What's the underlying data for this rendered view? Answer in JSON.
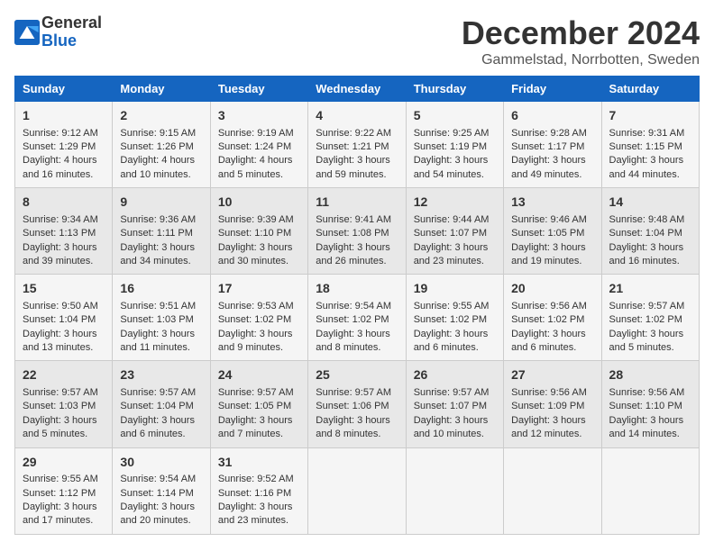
{
  "header": {
    "logo_general": "General",
    "logo_blue": "Blue",
    "month_title": "December 2024",
    "location": "Gammelstad, Norrbotten, Sweden"
  },
  "days_of_week": [
    "Sunday",
    "Monday",
    "Tuesday",
    "Wednesday",
    "Thursday",
    "Friday",
    "Saturday"
  ],
  "weeks": [
    [
      {
        "day": 1,
        "sunrise": "Sunrise: 9:12 AM",
        "sunset": "Sunset: 1:29 PM",
        "daylight": "Daylight: 4 hours and 16 minutes."
      },
      {
        "day": 2,
        "sunrise": "Sunrise: 9:15 AM",
        "sunset": "Sunset: 1:26 PM",
        "daylight": "Daylight: 4 hours and 10 minutes."
      },
      {
        "day": 3,
        "sunrise": "Sunrise: 9:19 AM",
        "sunset": "Sunset: 1:24 PM",
        "daylight": "Daylight: 4 hours and 5 minutes."
      },
      {
        "day": 4,
        "sunrise": "Sunrise: 9:22 AM",
        "sunset": "Sunset: 1:21 PM",
        "daylight": "Daylight: 3 hours and 59 minutes."
      },
      {
        "day": 5,
        "sunrise": "Sunrise: 9:25 AM",
        "sunset": "Sunset: 1:19 PM",
        "daylight": "Daylight: 3 hours and 54 minutes."
      },
      {
        "day": 6,
        "sunrise": "Sunrise: 9:28 AM",
        "sunset": "Sunset: 1:17 PM",
        "daylight": "Daylight: 3 hours and 49 minutes."
      },
      {
        "day": 7,
        "sunrise": "Sunrise: 9:31 AM",
        "sunset": "Sunset: 1:15 PM",
        "daylight": "Daylight: 3 hours and 44 minutes."
      }
    ],
    [
      {
        "day": 8,
        "sunrise": "Sunrise: 9:34 AM",
        "sunset": "Sunset: 1:13 PM",
        "daylight": "Daylight: 3 hours and 39 minutes."
      },
      {
        "day": 9,
        "sunrise": "Sunrise: 9:36 AM",
        "sunset": "Sunset: 1:11 PM",
        "daylight": "Daylight: 3 hours and 34 minutes."
      },
      {
        "day": 10,
        "sunrise": "Sunrise: 9:39 AM",
        "sunset": "Sunset: 1:10 PM",
        "daylight": "Daylight: 3 hours and 30 minutes."
      },
      {
        "day": 11,
        "sunrise": "Sunrise: 9:41 AM",
        "sunset": "Sunset: 1:08 PM",
        "daylight": "Daylight: 3 hours and 26 minutes."
      },
      {
        "day": 12,
        "sunrise": "Sunrise: 9:44 AM",
        "sunset": "Sunset: 1:07 PM",
        "daylight": "Daylight: 3 hours and 23 minutes."
      },
      {
        "day": 13,
        "sunrise": "Sunrise: 9:46 AM",
        "sunset": "Sunset: 1:05 PM",
        "daylight": "Daylight: 3 hours and 19 minutes."
      },
      {
        "day": 14,
        "sunrise": "Sunrise: 9:48 AM",
        "sunset": "Sunset: 1:04 PM",
        "daylight": "Daylight: 3 hours and 16 minutes."
      }
    ],
    [
      {
        "day": 15,
        "sunrise": "Sunrise: 9:50 AM",
        "sunset": "Sunset: 1:04 PM",
        "daylight": "Daylight: 3 hours and 13 minutes."
      },
      {
        "day": 16,
        "sunrise": "Sunrise: 9:51 AM",
        "sunset": "Sunset: 1:03 PM",
        "daylight": "Daylight: 3 hours and 11 minutes."
      },
      {
        "day": 17,
        "sunrise": "Sunrise: 9:53 AM",
        "sunset": "Sunset: 1:02 PM",
        "daylight": "Daylight: 3 hours and 9 minutes."
      },
      {
        "day": 18,
        "sunrise": "Sunrise: 9:54 AM",
        "sunset": "Sunset: 1:02 PM",
        "daylight": "Daylight: 3 hours and 8 minutes."
      },
      {
        "day": 19,
        "sunrise": "Sunrise: 9:55 AM",
        "sunset": "Sunset: 1:02 PM",
        "daylight": "Daylight: 3 hours and 6 minutes."
      },
      {
        "day": 20,
        "sunrise": "Sunrise: 9:56 AM",
        "sunset": "Sunset: 1:02 PM",
        "daylight": "Daylight: 3 hours and 6 minutes."
      },
      {
        "day": 21,
        "sunrise": "Sunrise: 9:57 AM",
        "sunset": "Sunset: 1:02 PM",
        "daylight": "Daylight: 3 hours and 5 minutes."
      }
    ],
    [
      {
        "day": 22,
        "sunrise": "Sunrise: 9:57 AM",
        "sunset": "Sunset: 1:03 PM",
        "daylight": "Daylight: 3 hours and 5 minutes."
      },
      {
        "day": 23,
        "sunrise": "Sunrise: 9:57 AM",
        "sunset": "Sunset: 1:04 PM",
        "daylight": "Daylight: 3 hours and 6 minutes."
      },
      {
        "day": 24,
        "sunrise": "Sunrise: 9:57 AM",
        "sunset": "Sunset: 1:05 PM",
        "daylight": "Daylight: 3 hours and 7 minutes."
      },
      {
        "day": 25,
        "sunrise": "Sunrise: 9:57 AM",
        "sunset": "Sunset: 1:06 PM",
        "daylight": "Daylight: 3 hours and 8 minutes."
      },
      {
        "day": 26,
        "sunrise": "Sunrise: 9:57 AM",
        "sunset": "Sunset: 1:07 PM",
        "daylight": "Daylight: 3 hours and 10 minutes."
      },
      {
        "day": 27,
        "sunrise": "Sunrise: 9:56 AM",
        "sunset": "Sunset: 1:09 PM",
        "daylight": "Daylight: 3 hours and 12 minutes."
      },
      {
        "day": 28,
        "sunrise": "Sunrise: 9:56 AM",
        "sunset": "Sunset: 1:10 PM",
        "daylight": "Daylight: 3 hours and 14 minutes."
      }
    ],
    [
      {
        "day": 29,
        "sunrise": "Sunrise: 9:55 AM",
        "sunset": "Sunset: 1:12 PM",
        "daylight": "Daylight: 3 hours and 17 minutes."
      },
      {
        "day": 30,
        "sunrise": "Sunrise: 9:54 AM",
        "sunset": "Sunset: 1:14 PM",
        "daylight": "Daylight: 3 hours and 20 minutes."
      },
      {
        "day": 31,
        "sunrise": "Sunrise: 9:52 AM",
        "sunset": "Sunset: 1:16 PM",
        "daylight": "Daylight: 3 hours and 23 minutes."
      },
      null,
      null,
      null,
      null
    ]
  ]
}
